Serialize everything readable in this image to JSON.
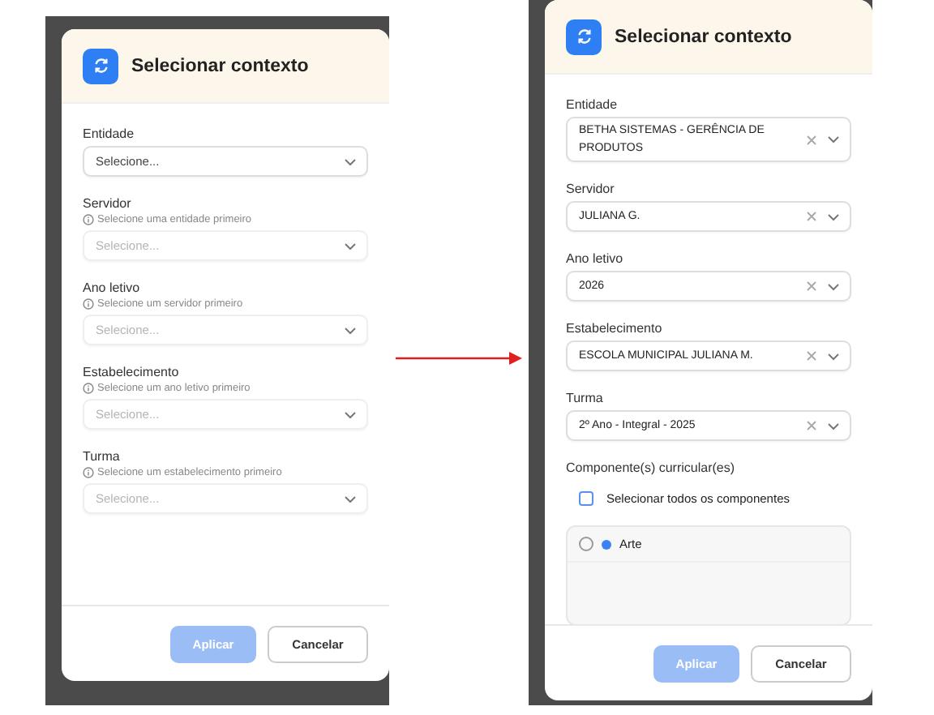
{
  "screens": [
    {
      "title": "Selecionar contexto",
      "fields": [
        {
          "label": "Entidade",
          "placeholder": "Selecione...",
          "disabled": false
        },
        {
          "label": "Servidor",
          "hint": "Selecione uma entidade primeiro",
          "placeholder": "Selecione...",
          "disabled": true
        },
        {
          "label": "Ano letivo",
          "hint": "Selecione um servidor primeiro",
          "placeholder": "Selecione...",
          "disabled": true
        },
        {
          "label": "Estabelecimento",
          "hint": "Selecione um ano letivo primeiro",
          "placeholder": "Selecione...",
          "disabled": true
        },
        {
          "label": "Turma",
          "hint": "Selecione um estabelecimento primeiro",
          "placeholder": "Selecione...",
          "disabled": true
        }
      ],
      "buttons": [
        {
          "label": "Aplicar",
          "kind": "primary",
          "disabled": true
        },
        {
          "label": "Cancelar",
          "kind": "secondary",
          "disabled": false
        }
      ]
    },
    {
      "title": "Selecionar contexto",
      "fields": [
        {
          "label": "Entidade",
          "value": "BETHA SISTEMAS - GERÊNCIA DE PRODUTOS",
          "disabled": false
        },
        {
          "label": "Servidor",
          "value": "JULIANA G.",
          "disabled": false
        },
        {
          "label": "Ano letivo",
          "value": "2026",
          "disabled": false
        },
        {
          "label": "Estabelecimento",
          "value": "ESCOLA MUNICIPAL JULIANA M.",
          "disabled": false
        },
        {
          "label": "Turma",
          "value": "2º Ano - Integral - 2025",
          "disabled": false
        }
      ],
      "components": {
        "label": "Componente(s) curricular(es)",
        "select_all": {
          "label": "Selecionar todos os componentes",
          "checked": false
        },
        "items": [
          {
            "label": "Arte",
            "checked": false,
            "color": "#3b82f6"
          }
        ]
      },
      "buttons": [
        {
          "label": "Aplicar",
          "kind": "primary",
          "disabled": true
        },
        {
          "label": "Cancelar",
          "kind": "secondary",
          "disabled": false
        }
      ]
    }
  ]
}
